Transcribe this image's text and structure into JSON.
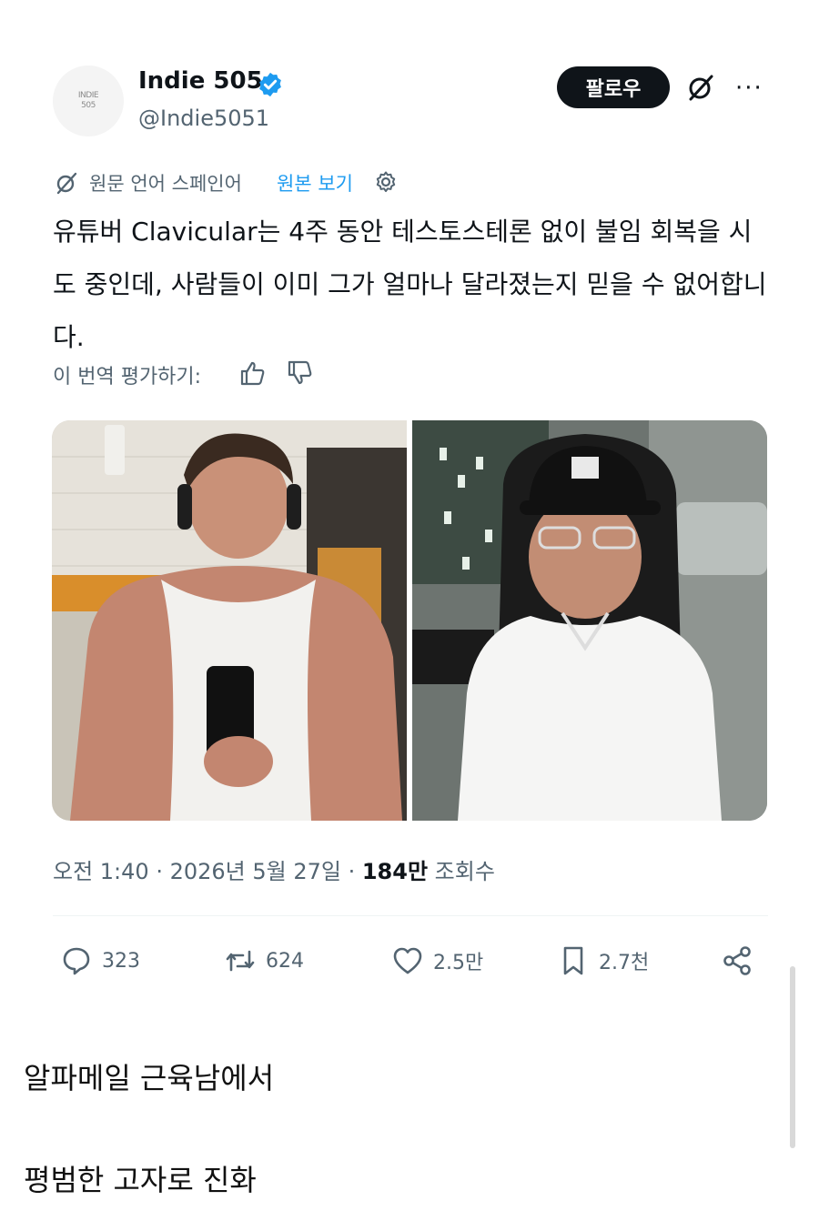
{
  "account": {
    "avatar_text_line1": "INDIE",
    "avatar_text_line2": "505",
    "display_name": "Indie 505",
    "handle": "@Indie5051",
    "verified_icon": "verified-badge-icon",
    "verified_color": "#1d9bf0"
  },
  "header": {
    "follow_label": "팔로우",
    "grok_icon": "grok-icon",
    "more_label": "···"
  },
  "translation": {
    "label": "원문 언어 스페인어",
    "link": "원본 보기",
    "link_color": "#1d9bf0"
  },
  "tweet": {
    "text": "유튜버 Clavicular는 4주 동안 테스토스테론 없이 불임 회복을 시도 중인데, 사람들이 이미 그가 얼마나 달라졌는지 믿을 수 없어합니다."
  },
  "rating": {
    "label": "이 번역 평가하기:"
  },
  "meta": {
    "time": "오전 1:40",
    "sep1": " · ",
    "date": "2026년 5월 27일",
    "sep2": " · ",
    "views_count": "184만",
    "views_label": " 조회수"
  },
  "actions": {
    "replies": "323",
    "reposts": "624",
    "likes": "2.5만",
    "bookmarks": "2.7천"
  },
  "captions": {
    "line1": "알파메일 근육남에서",
    "line2": "평범한 고자로 진화"
  }
}
